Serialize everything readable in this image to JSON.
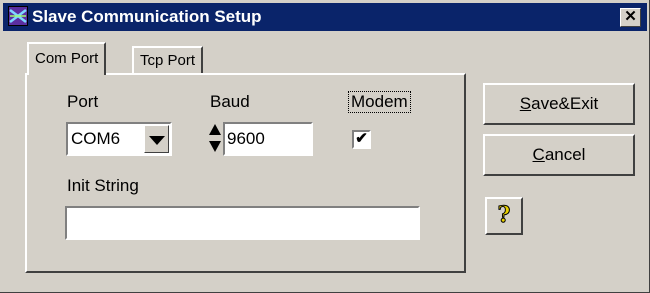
{
  "window": {
    "title": "Slave Communication Setup",
    "title_icon": "app-logo-icon",
    "close_glyph": "✕",
    "accent": "#0a246a",
    "face": "#d4d0c8"
  },
  "tabs": [
    {
      "label": "Com Port",
      "active": true
    },
    {
      "label": "Tcp Port",
      "active": false
    }
  ],
  "form": {
    "port_label": "Port",
    "port_value": "COM6",
    "baud_label": "Baud",
    "baud_value": "9600",
    "modem_label": "Modem",
    "modem_checked": true,
    "modem_check_glyph": "✔",
    "init_label": "Init String",
    "init_value": ""
  },
  "buttons": {
    "save_first": "S",
    "save_rest": "ave&Exit",
    "cancel_first": "C",
    "cancel_rest": "ancel",
    "help_glyph": "?",
    "help_icon": "help-icon"
  }
}
